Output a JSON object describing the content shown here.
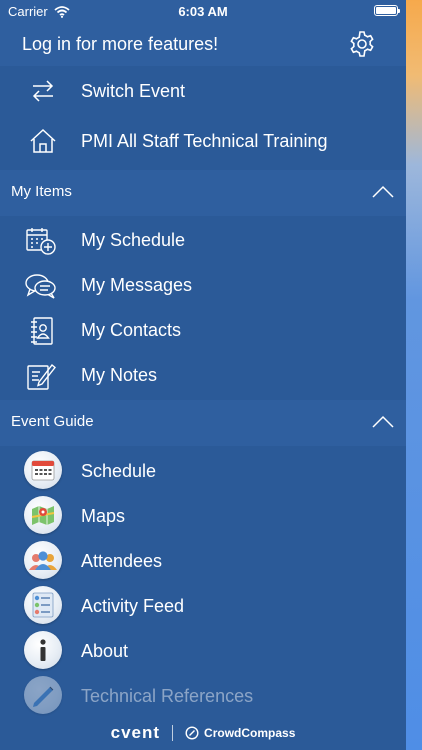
{
  "status_bar": {
    "carrier": "Carrier",
    "time": "6:03 AM"
  },
  "header": {
    "login_text": "Log in for more features!"
  },
  "top_items": [
    {
      "label": "Switch Event",
      "icon": "switch-arrows-icon"
    },
    {
      "label": "PMI All Staff Technical Training",
      "icon": "home-icon"
    }
  ],
  "my_items": {
    "title": "My Items",
    "items": [
      {
        "label": "My Schedule",
        "icon": "calendar-add-icon"
      },
      {
        "label": "My Messages",
        "icon": "chat-bubbles-icon"
      },
      {
        "label": "My Contacts",
        "icon": "contacts-book-icon"
      },
      {
        "label": "My Notes",
        "icon": "notes-pencil-icon"
      }
    ]
  },
  "event_guide": {
    "title": "Event Guide",
    "items": [
      {
        "label": "Schedule",
        "icon": "schedule-calendar-icon"
      },
      {
        "label": "Maps",
        "icon": "map-icon"
      },
      {
        "label": "Attendees",
        "icon": "attendees-icon"
      },
      {
        "label": "Activity Feed",
        "icon": "activity-feed-icon"
      },
      {
        "label": "About",
        "icon": "info-icon"
      },
      {
        "label": "Technical References",
        "icon": "pencil-icon"
      }
    ]
  },
  "footer": {
    "brand": "cvent",
    "partner": "CrowdCompass"
  },
  "colors": {
    "drawer_bg": "#2b5a98",
    "header_bg": "#2f5f9f",
    "text": "#ffffff"
  }
}
